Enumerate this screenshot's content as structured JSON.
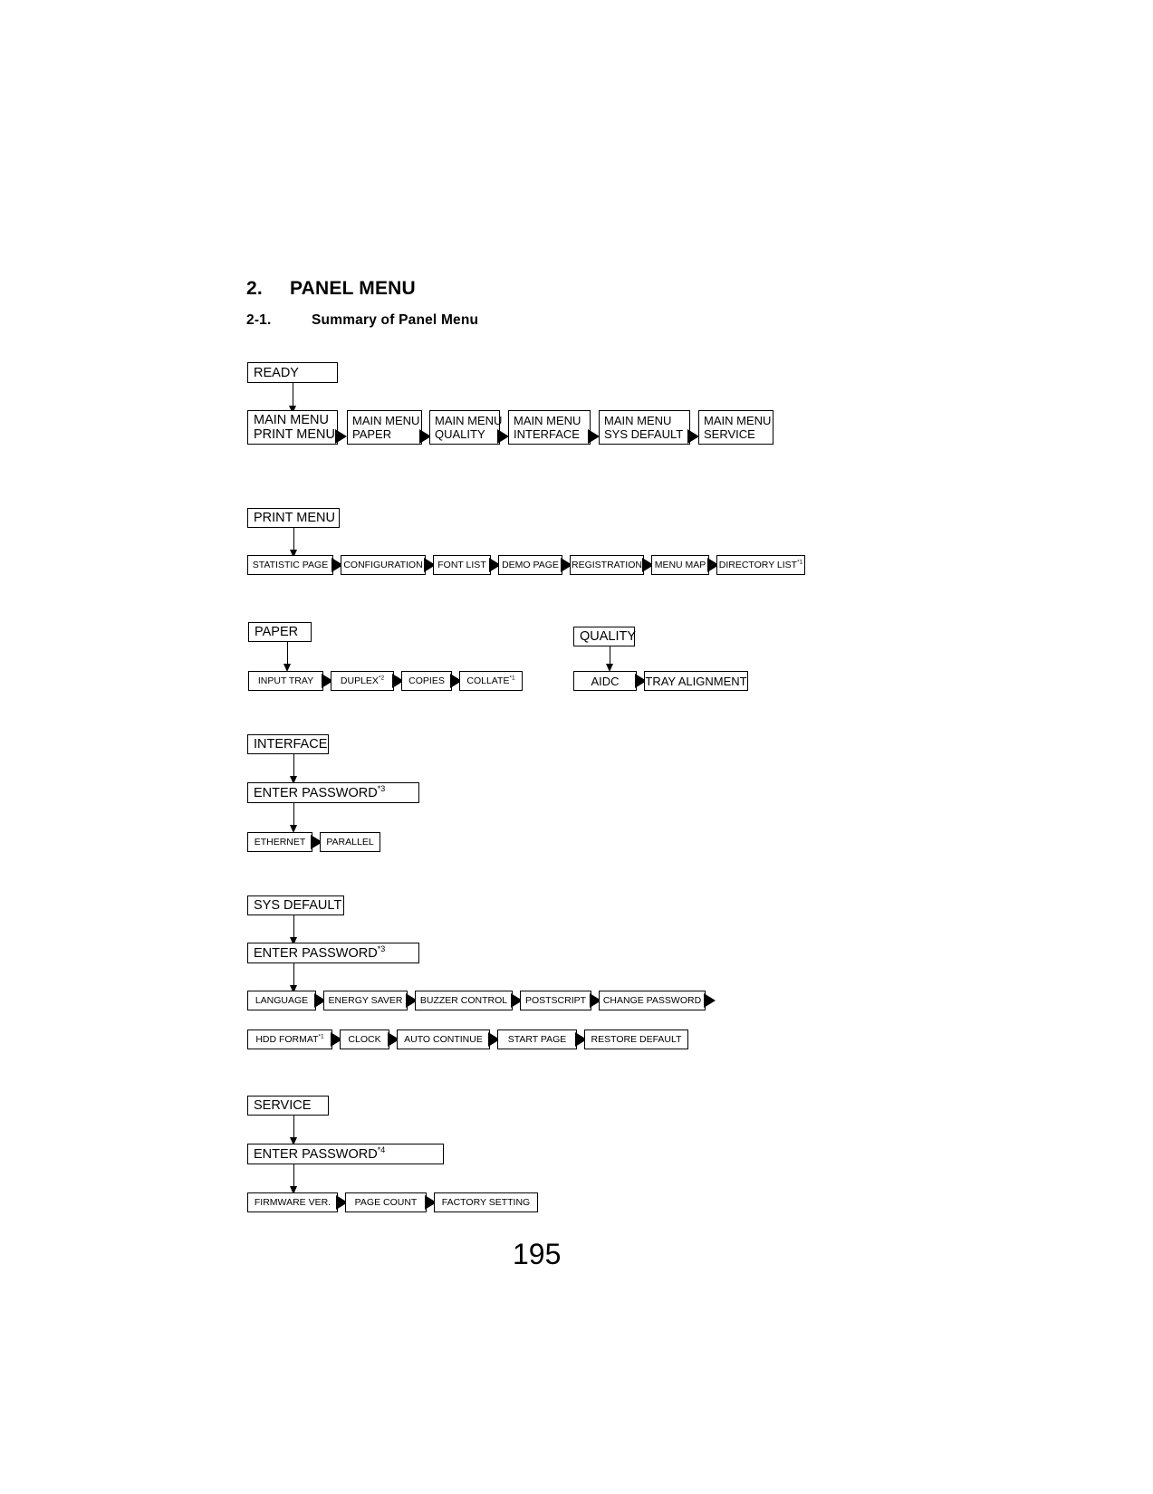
{
  "document": {
    "section_number": "2.",
    "section_title": "PANEL MENU",
    "subsection_number": "2-1.",
    "subsection_title": "Summary of Panel Menu",
    "page_number": "195"
  },
  "diagram": {
    "ready": {
      "label": "READY"
    },
    "main_menu_row": [
      {
        "line1": "MAIN MENU",
        "line2": "PRINT MENU"
      },
      {
        "line1": "MAIN MENU",
        "line2": "PAPER"
      },
      {
        "line1": "MAIN MENU",
        "line2": "QUALITY"
      },
      {
        "line1": "MAIN MENU",
        "line2": "INTERFACE"
      },
      {
        "line1": "MAIN MENU",
        "line2": "SYS DEFAULT"
      },
      {
        "line1": "MAIN MENU",
        "line2": "SERVICE"
      }
    ],
    "print_menu": {
      "header": "PRINT MENU",
      "items": [
        {
          "label": "STATISTIC PAGE",
          "note": ""
        },
        {
          "label": "CONFIGURATION",
          "note": ""
        },
        {
          "label": "FONT LIST",
          "note": ""
        },
        {
          "label": "DEMO PAGE",
          "note": ""
        },
        {
          "label": "REGISTRATION",
          "note": ""
        },
        {
          "label": "MENU MAP",
          "note": ""
        },
        {
          "label": "DIRECTORY LIST",
          "note": "*1"
        }
      ]
    },
    "paper": {
      "header": "PAPER",
      "items": [
        {
          "label": "INPUT TRAY",
          "note": ""
        },
        {
          "label": "DUPLEX",
          "note": "*2"
        },
        {
          "label": "COPIES",
          "note": ""
        },
        {
          "label": "COLLATE",
          "note": "*1"
        }
      ]
    },
    "quality": {
      "header": "QUALITY",
      "items": [
        {
          "label": "AIDC",
          "note": ""
        },
        {
          "label": "TRAY ALIGNMENT",
          "note": ""
        }
      ]
    },
    "interface": {
      "header": "INTERFACE",
      "password": {
        "label": "ENTER PASSWORD",
        "note": "*3"
      },
      "items": [
        {
          "label": "ETHERNET",
          "note": ""
        },
        {
          "label": "PARALLEL",
          "note": ""
        }
      ]
    },
    "sys_default": {
      "header": "SYS DEFAULT",
      "password": {
        "label": "ENTER PASSWORD",
        "note": "*3"
      },
      "items_row1": [
        {
          "label": "LANGUAGE",
          "note": ""
        },
        {
          "label": "ENERGY SAVER",
          "note": ""
        },
        {
          "label": "BUZZER CONTROL",
          "note": ""
        },
        {
          "label": "POSTSCRIPT",
          "note": ""
        },
        {
          "label": "CHANGE PASSWORD",
          "note": ""
        }
      ],
      "items_row2": [
        {
          "label": "HDD FORMAT",
          "note": "*1"
        },
        {
          "label": "CLOCK",
          "note": ""
        },
        {
          "label": "AUTO CONTINUE",
          "note": ""
        },
        {
          "label": "START PAGE",
          "note": ""
        },
        {
          "label": "RESTORE DEFAULT",
          "note": ""
        }
      ]
    },
    "service": {
      "header": "SERVICE",
      "password": {
        "label": "ENTER PASSWORD",
        "note": "*4"
      },
      "items": [
        {
          "label": "FIRMWARE VER.",
          "note": ""
        },
        {
          "label": "PAGE COUNT",
          "note": ""
        },
        {
          "label": "FACTORY SETTING",
          "note": ""
        }
      ]
    }
  }
}
